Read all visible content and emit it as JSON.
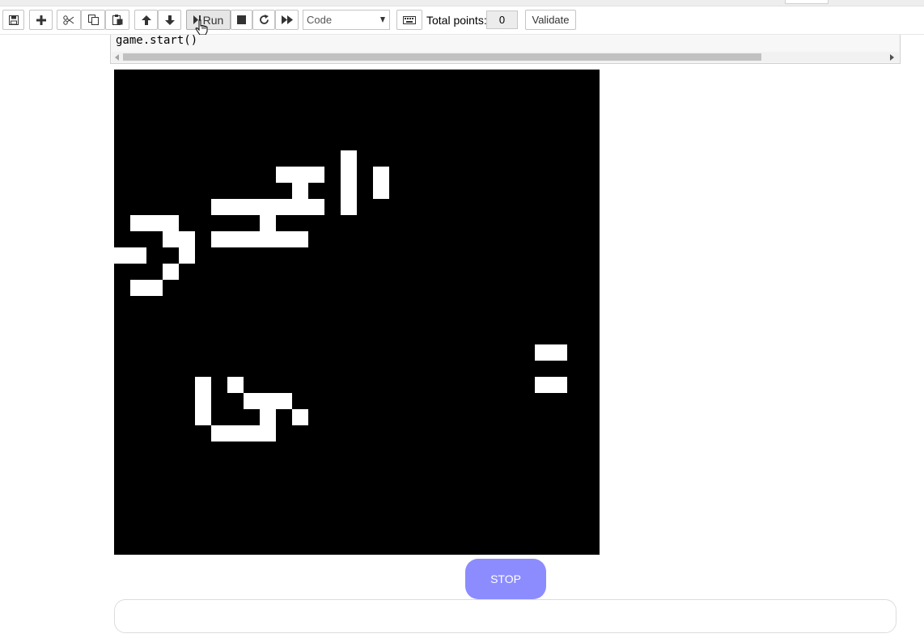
{
  "toolbar": {
    "buttons": [
      {
        "name": "save-button",
        "icon": "save-icon"
      },
      {
        "name": "insert-cell-button",
        "icon": "plus-icon"
      },
      {
        "name": "cut-button",
        "icon": "scissors-icon"
      },
      {
        "name": "copy-button",
        "icon": "copy-icon"
      },
      {
        "name": "paste-button",
        "icon": "paste-icon"
      },
      {
        "name": "move-up-button",
        "icon": "arrow-up-icon"
      },
      {
        "name": "move-down-button",
        "icon": "arrow-down-icon"
      },
      {
        "name": "interrupt-button",
        "icon": "stop-square-icon"
      },
      {
        "name": "restart-button",
        "icon": "restart-icon"
      },
      {
        "name": "run-all-button",
        "icon": "fast-forward-icon"
      },
      {
        "name": "command-palette-button",
        "icon": "keyboard-icon"
      }
    ],
    "run_label": "Run",
    "cell_type": "Code",
    "total_points_label": "Total points:",
    "total_points_value": "0",
    "validate_label": "Validate"
  },
  "code_cell": {
    "code_line": "game.start()"
  },
  "game": {
    "grid_columns": 30,
    "grid_rows": 30,
    "cell_color": "#ffffff",
    "background": "#000000",
    "live_cells": [
      [
        14,
        5
      ],
      [
        10,
        6
      ],
      [
        11,
        6
      ],
      [
        12,
        6
      ],
      [
        14,
        6
      ],
      [
        16,
        6
      ],
      [
        11,
        7
      ],
      [
        14,
        7
      ],
      [
        16,
        7
      ],
      [
        6,
        8
      ],
      [
        7,
        8
      ],
      [
        8,
        8
      ],
      [
        9,
        8
      ],
      [
        10,
        8
      ],
      [
        11,
        8
      ],
      [
        12,
        8
      ],
      [
        14,
        8
      ],
      [
        1,
        9
      ],
      [
        2,
        9
      ],
      [
        3,
        9
      ],
      [
        9,
        9
      ],
      [
        3,
        10
      ],
      [
        4,
        10
      ],
      [
        6,
        10
      ],
      [
        7,
        10
      ],
      [
        8,
        10
      ],
      [
        9,
        10
      ],
      [
        10,
        10
      ],
      [
        11,
        10
      ],
      [
        0,
        11
      ],
      [
        1,
        11
      ],
      [
        4,
        11
      ],
      [
        3,
        12
      ],
      [
        1,
        13
      ],
      [
        2,
        13
      ],
      [
        26,
        17
      ],
      [
        27,
        17
      ],
      [
        26,
        19
      ],
      [
        27,
        19
      ],
      [
        5,
        19
      ],
      [
        7,
        19
      ],
      [
        5,
        20
      ],
      [
        8,
        20
      ],
      [
        9,
        20
      ],
      [
        10,
        20
      ],
      [
        5,
        21
      ],
      [
        9,
        21
      ],
      [
        11,
        21
      ],
      [
        6,
        22
      ],
      [
        7,
        22
      ],
      [
        8,
        22
      ],
      [
        9,
        22
      ]
    ]
  },
  "stop_button": {
    "label": "STOP",
    "color": "#8c8cff"
  },
  "output_area": {
    "value": ""
  }
}
